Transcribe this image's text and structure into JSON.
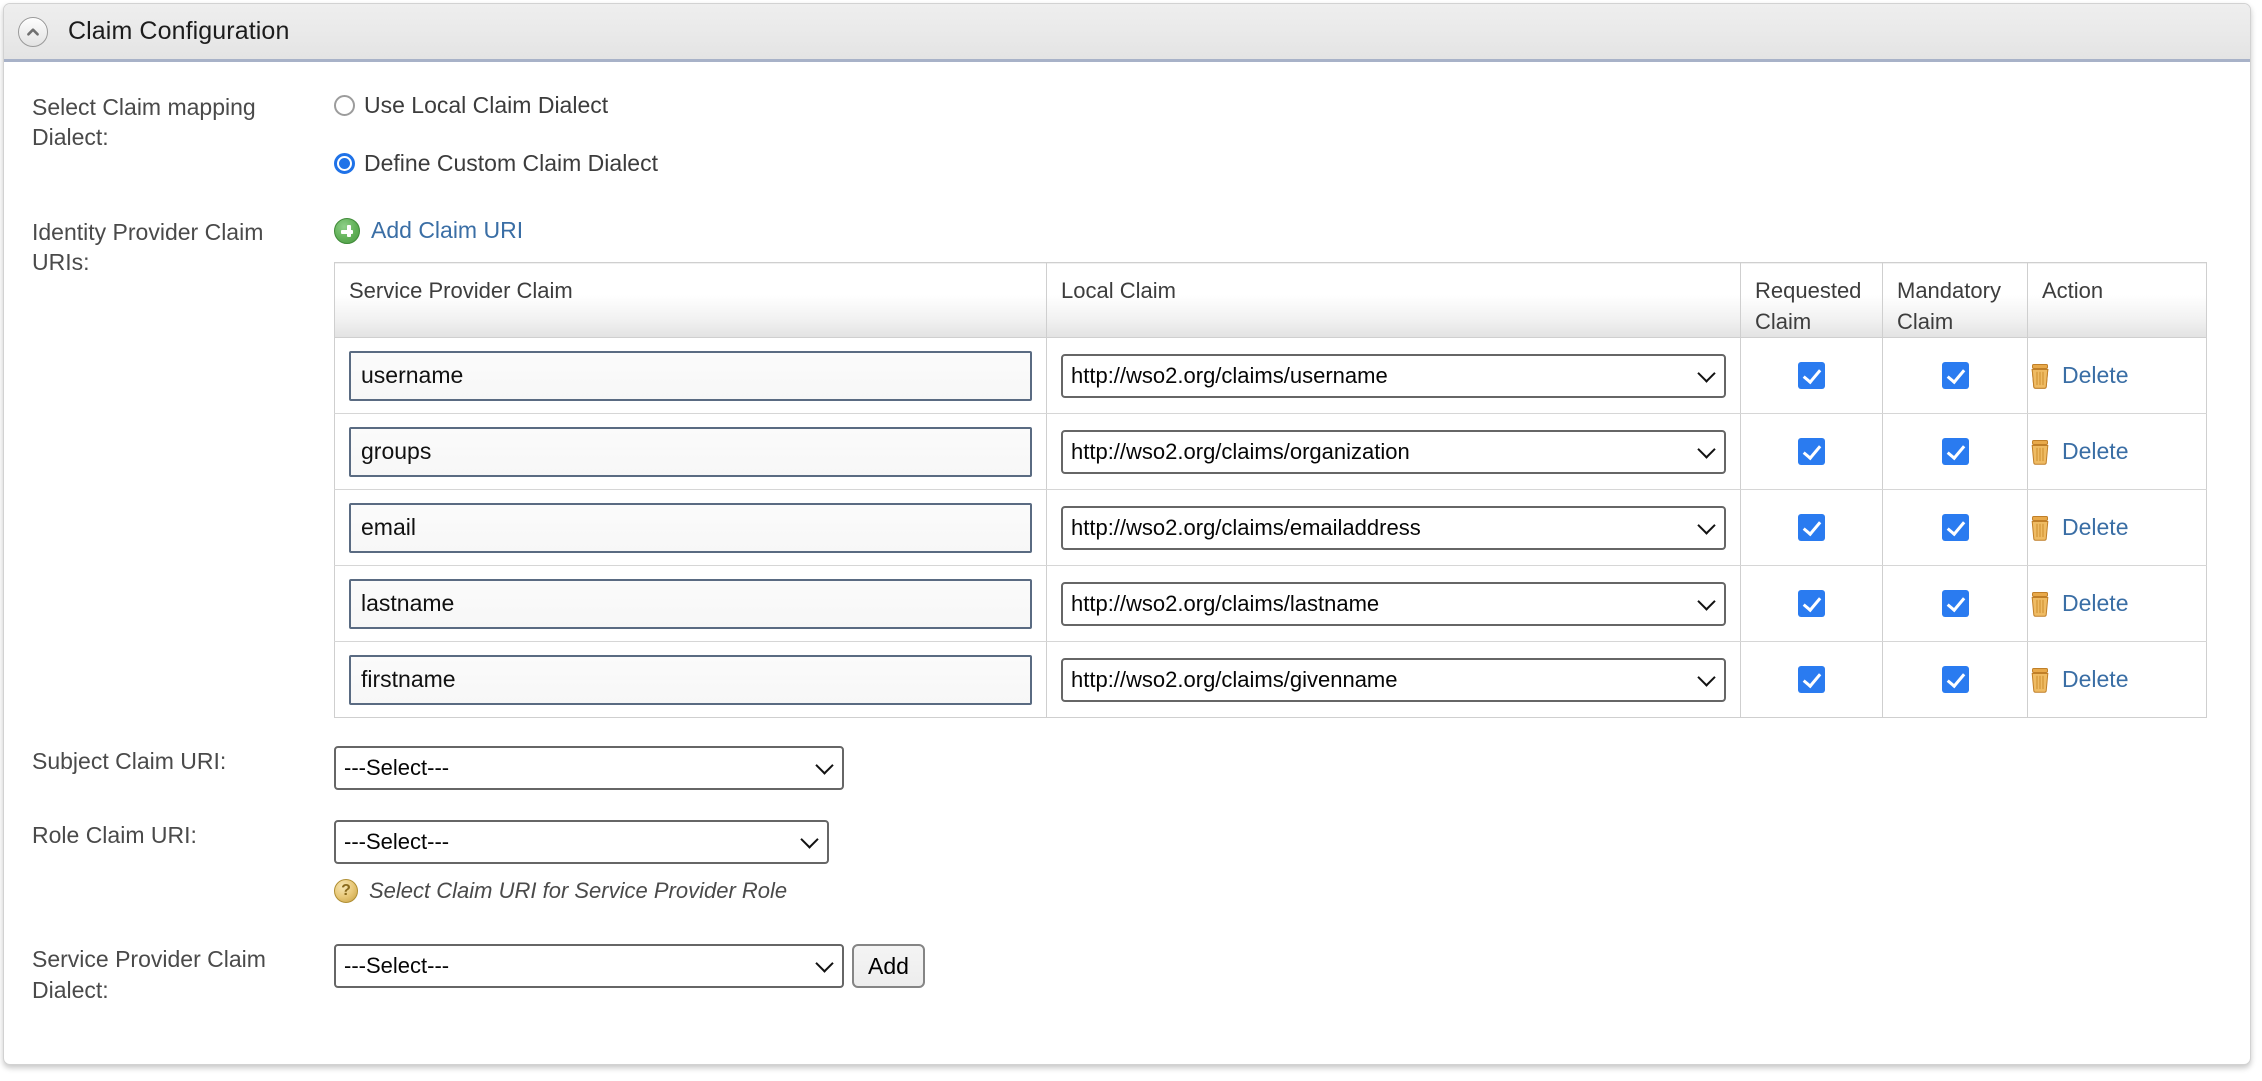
{
  "panel": {
    "title": "Claim Configuration",
    "collapse_icon": "chevron-up-icon"
  },
  "claim_mapping": {
    "label": "Select Claim mapping Dialect:",
    "options": [
      {
        "label": "Use Local Claim Dialect",
        "selected": false
      },
      {
        "label": "Define Custom Claim Dialect",
        "selected": true
      }
    ]
  },
  "idp_claim_uris": {
    "label": "Identity Provider Claim URIs:",
    "add_link": "Add Claim URI",
    "add_icon": "plus-circle-icon",
    "table": {
      "headers": [
        "Service Provider Claim",
        "Local Claim",
        "Requested Claim",
        "Mandatory Claim",
        "Action"
      ],
      "rows": [
        {
          "service_provider_claim": "username",
          "local_claim": "http://wso2.org/claims/username",
          "requested_claim": true,
          "mandatory_claim": true,
          "action_label": "Delete"
        },
        {
          "service_provider_claim": "groups",
          "local_claim": "http://wso2.org/claims/organization",
          "requested_claim": true,
          "mandatory_claim": true,
          "action_label": "Delete"
        },
        {
          "service_provider_claim": "email",
          "local_claim": "http://wso2.org/claims/emailaddress",
          "requested_claim": true,
          "mandatory_claim": true,
          "action_label": "Delete"
        },
        {
          "service_provider_claim": "lastname",
          "local_claim": "http://wso2.org/claims/lastname",
          "requested_claim": true,
          "mandatory_claim": true,
          "action_label": "Delete"
        },
        {
          "service_provider_claim": "firstname",
          "local_claim": "http://wso2.org/claims/givenname",
          "requested_claim": true,
          "mandatory_claim": true,
          "action_label": "Delete"
        }
      ]
    }
  },
  "subject_claim_uri": {
    "label": "Subject Claim URI:",
    "value": "---Select---"
  },
  "role_claim_uri": {
    "label": "Role Claim URI:",
    "value": "---Select---",
    "hint": "Select Claim URI for Service Provider Role",
    "hint_icon": "help-circle-icon"
  },
  "sp_claim_dialect": {
    "label": "Service Provider Claim Dialect:",
    "value": "---Select---",
    "add_button": "Add"
  },
  "colors": {
    "link": "#3a6ea5",
    "checkbox": "#2a7bf0",
    "radio_selected": "#1f72e8",
    "header_accent": "#a8b2c8",
    "input_border": "#5a6b82"
  }
}
